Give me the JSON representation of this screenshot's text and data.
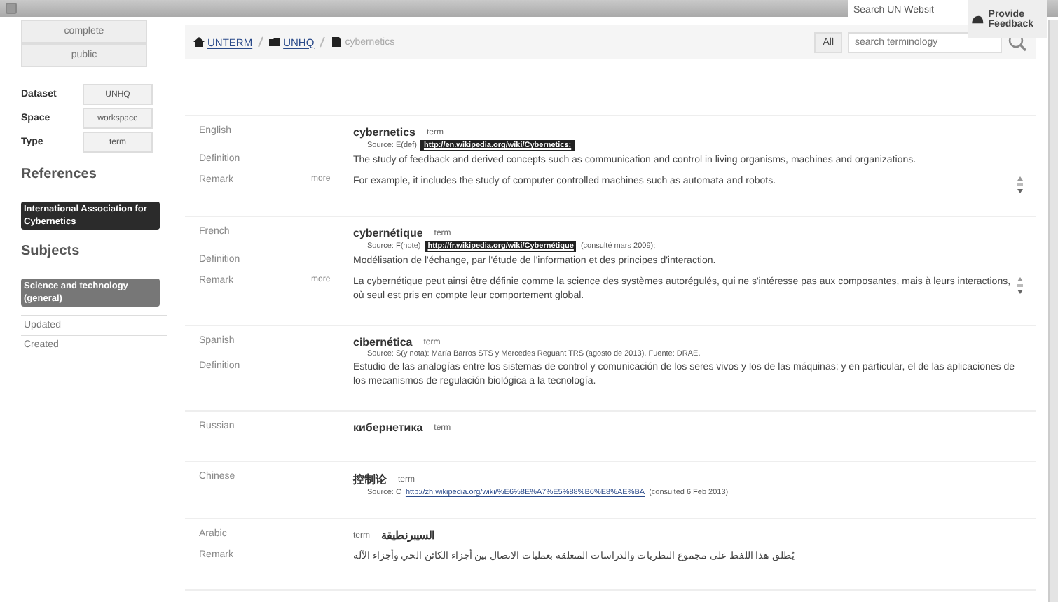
{
  "top_bar": {
    "search": {
      "value": "Search UN Websit"
    },
    "feedback": "Provide Feedback"
  },
  "sidebar": {
    "status_buttons": [
      "complete",
      "public"
    ],
    "meta": [
      {
        "label": "Dataset",
        "value": "UNHQ"
      },
      {
        "label": "Space",
        "value": "workspace"
      },
      {
        "label": "Type",
        "value": "term"
      }
    ],
    "references_heading": "References",
    "references": [
      "International Association for Cybernetics"
    ],
    "subjects_heading": "Subjects",
    "subjects": [
      "Science and technology (general)"
    ],
    "footer_items": [
      "Updated",
      "Created"
    ]
  },
  "breadcrumb": [
    {
      "label": "UNTERM",
      "kind": "home",
      "link": true
    },
    {
      "label": "UNHQ",
      "kind": "folder",
      "link": true
    },
    {
      "label": "cybernetics",
      "kind": "document",
      "link": false
    }
  ],
  "search": {
    "scope": "All",
    "placeholder": "search terminology"
  },
  "entries": [
    {
      "language": "English",
      "term": "cybernetics",
      "term_type": "term",
      "rtl": false,
      "source": {
        "prefix": "Source: E(def)",
        "link": "http://en.wikipedia.org/wiki/Cybernetics;",
        "highlighted": true
      },
      "rows": [
        {
          "label": "Definition",
          "text": "The study of feedback and derived concepts such as communication and control in living organisms, machines and organizations.",
          "scrollable": false
        },
        {
          "label": "Remark",
          "more": "more",
          "text": "For example, it includes the study of computer controlled machines such as automata and robots.",
          "scrollable": true
        }
      ]
    },
    {
      "language": "French",
      "term": "cybernétique",
      "term_type": "term",
      "rtl": false,
      "source": {
        "prefix": "Source: F(note)",
        "link": "http://fr.wikipedia.org/wiki/Cybernétique",
        "suffix": "(consulté mars 2009);",
        "highlighted": true
      },
      "rows": [
        {
          "label": "Definition",
          "text": "Modélisation de l'échange, par l'étude de l'information et des principes d'interaction.",
          "scrollable": false
        },
        {
          "label": "Remark",
          "more": "more",
          "text": "La cybernétique peut ainsi être définie comme la science des systèmes autorégulés, qui ne s'intéresse pas aux composantes, mais à leurs interactions, où seul est pris en compte leur comportement global.",
          "scrollable": true
        }
      ]
    },
    {
      "language": "Spanish",
      "term": "cibernética",
      "term_type": "term",
      "rtl": false,
      "source": {
        "prefix": "Source: S(y nota): María Barros STS y Mercedes Reguant TRS (agosto de 2013). Fuente: DRAE."
      },
      "rows": [
        {
          "label": "Definition",
          "text": "Estudio de las analogías entre los sistemas de control y comunicación de los seres vivos y los de las máquinas; y en particular, el de las aplicaciones de los mecanismos de regulación biológica a la tecnología.",
          "scrollable": false
        }
      ]
    },
    {
      "language": "Russian",
      "term": "кибернетика",
      "term_type": "term",
      "rtl": false
    },
    {
      "language": "Chinese",
      "term": "控制论",
      "term_type": "term",
      "rtl": false,
      "source": {
        "prefix": "Source: C",
        "link": "http://zh.wikipedia.org/wiki/%E6%8E%A7%E5%88%B6%E8%AE%BA",
        "suffix": "(consulted 6 Feb 2013)",
        "highlighted": false
      }
    },
    {
      "language": "Arabic",
      "term": "السيبرنطيقة",
      "term_type": "term",
      "rtl": true,
      "rows": [
        {
          "label": "Remark",
          "text": "يُطلق هذا اللفظ على مجموع النظريات والدراسات المتعلقة بعمليات الاتصال بين أجزاء الكائن الحي وأجزاء الآلة",
          "scrollable": false
        }
      ]
    }
  ]
}
